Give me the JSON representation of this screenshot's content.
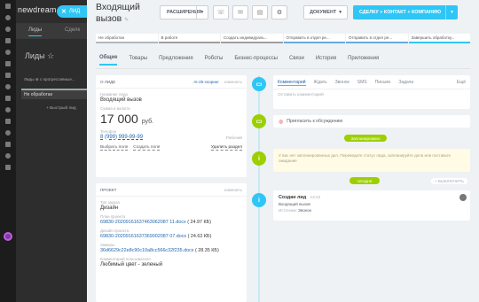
{
  "background_app": {
    "logo": "newdream",
    "tabs": [
      "Лиды",
      "Сделк"
    ],
    "title": "Лиды ☆",
    "filter": "Лиды ⊗ с прогрессивные...",
    "column": "Не обработан",
    "add_lead": "+ Быстрый лид"
  },
  "close_button": {
    "icon": "close-icon",
    "label": "ЛИД"
  },
  "lead": {
    "title": "Входящий вызов",
    "edit_icon": "pencil-icon"
  },
  "toolbar": {
    "extensions_label": "РАСШИРЕНИЯ",
    "document_label": "ДОКУМЕНТ",
    "deal_label": "СДЕЛКУ + КОНТАКТ + КОМПАНИЮ",
    "icons": [
      "phone-icon",
      "mail-icon",
      "chat-icon",
      "gear-icon"
    ]
  },
  "stages": [
    "Не обработан",
    "В работе",
    "Создать индивидуаль...",
    "Отправить в отдел ре...",
    "Отправить в отдел ре...",
    "Завершить обработку..."
  ],
  "tabs": [
    "Общие",
    "Товары",
    "Предложения",
    "Роботы",
    "Бизнес-процессы",
    "Связи",
    "История",
    "Приложения"
  ],
  "about": {
    "heading": "О ЛИДЕ",
    "ai_label": "AI-25-скоринг",
    "edit_label": "изменить",
    "name_label": "Название лида",
    "name_value": "Входящий вызов",
    "amount_label": "Сумма и валюта",
    "amount_value": "17 000",
    "currency": "руб.",
    "phone_label": "Телефон",
    "phone_value": "8 (999) 999-99-99",
    "phone_type": "Рабочий",
    "choose_field": "Выбрать поле",
    "create_field": "Создать поле",
    "delete_section": "Удалить раздел"
  },
  "project": {
    "heading": "ПРОЕКТ",
    "edit_label": "изменить",
    "order_type_label": "Тип заказа",
    "order_type_value": "Дизайн",
    "plan_label": "План проекта",
    "plan_file": "69830-20209161637463062087 11.docx",
    "plan_size": "( 24.97 КБ)",
    "design_label": "Дизайн проекта",
    "design_file": "69830-20209161637369002087 07.docx",
    "design_size": "( 24.62 КБ)",
    "measure_label": "Замеры",
    "measure_file": "36d6629c22e8c90c10a8cc566c32f235.docx",
    "measure_size": "( 28.35 КБ)",
    "comment_label": "Комментарий пользователя",
    "comment_value": "Любимый цвет - зеленый"
  },
  "timeline": {
    "composer_tabs": [
      "Комментарий",
      "Ждать",
      "Звонок",
      "SMS",
      "Письмо",
      "Задача"
    ],
    "more": "Ещё",
    "placeholder": "Оставить комментарий",
    "invite": "Пригласить к обсуждению",
    "planned_pill": "Запланировано",
    "warning": "У вас нет запланированных дел. Переведите статус лида, запланируйте дела или поставьте ожидание",
    "today_pill": "сегодня",
    "expand": "+ ВЫКЛЮЧИТЬ",
    "event_title": "Создан лид",
    "event_time": "14:42",
    "event_name": "Входящий вызов",
    "event_source_label": "Источник:",
    "event_source_value": "Звонок"
  },
  "colors": {
    "accent": "#2fc6f6",
    "planned": "#9dcf00",
    "link": "#2067b0"
  }
}
